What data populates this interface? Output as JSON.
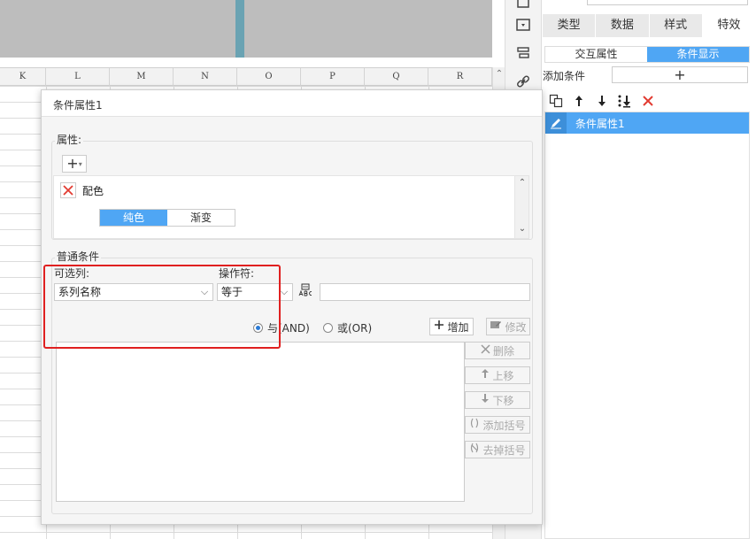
{
  "sheet": {
    "columns": [
      "K",
      "L",
      "M",
      "N",
      "O",
      "P",
      "Q",
      "R"
    ]
  },
  "right_panel": {
    "tabs": [
      {
        "label": "类型",
        "active": false
      },
      {
        "label": "数据",
        "active": false
      },
      {
        "label": "样式",
        "active": false
      },
      {
        "label": "特效",
        "active": true
      }
    ],
    "subtabs": [
      {
        "label": "交互属性",
        "active": false
      },
      {
        "label": "条件显示",
        "active": true
      }
    ],
    "add_condition_label": "添加条件",
    "add_condition_button": "+",
    "toolbar_icons": [
      "copy-icon",
      "arrow-up-icon",
      "arrow-down-icon",
      "move-bottom-icon",
      "delete-icon"
    ],
    "list_items": [
      {
        "label": "条件属性1"
      }
    ]
  },
  "dialog": {
    "title": "条件属性1",
    "property_group": {
      "legend": "属性:",
      "add_button": "+",
      "items": [
        {
          "name": "配色",
          "options": [
            "纯色",
            "渐变"
          ],
          "selected": "纯色"
        }
      ]
    },
    "condition_group": {
      "legend": "普通条件",
      "column_label": "可选列:",
      "column_value": "系列名称",
      "operator_label": "操作符:",
      "operator_value": "等于",
      "value_input": "",
      "and_label": "与(AND)",
      "or_label": "或(OR)",
      "and_selected": true,
      "add_button": "增加",
      "modify_button": "修改",
      "delete_button": "删除",
      "up_button": "上移",
      "down_button": "下移",
      "add_bracket_button": "添加括号",
      "remove_bracket_button": "去掉括号"
    }
  },
  "colors": {
    "accent": "#4fa6f4",
    "delete_red": "#e23c32",
    "highlight_red": "#e02020"
  }
}
